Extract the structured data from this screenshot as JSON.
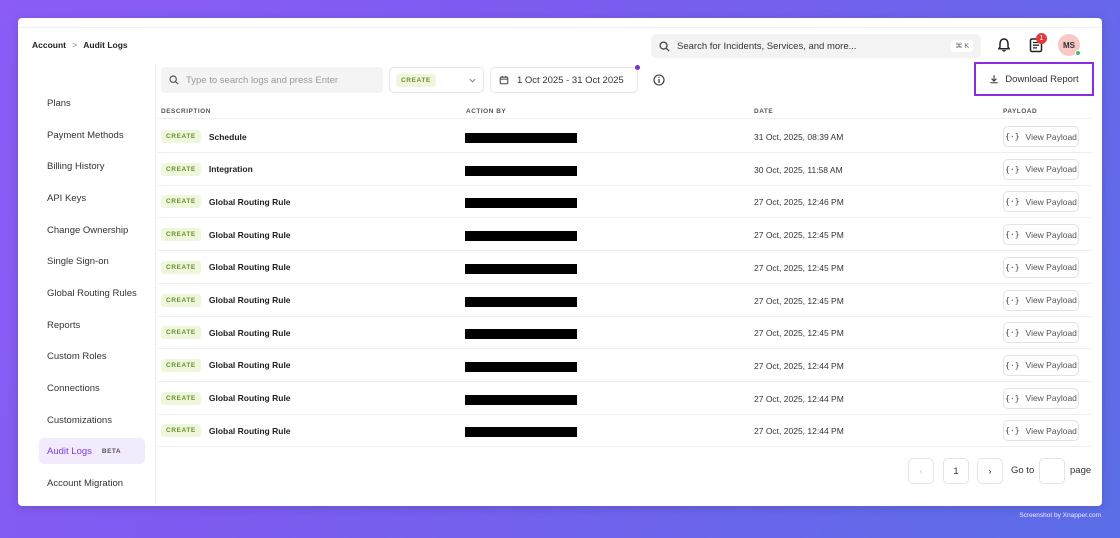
{
  "breadcrumb": {
    "parent": "Account",
    "separator": ">",
    "current": "Audit Logs"
  },
  "header": {
    "search_placeholder": "Search for Incidents, Services, and more...",
    "search_shortcut": "⌘ K",
    "notification_count": "1",
    "avatar_initials": "MS"
  },
  "sidebar": {
    "items": [
      {
        "label": "Plans"
      },
      {
        "label": "Payment Methods"
      },
      {
        "label": "Billing History"
      },
      {
        "label": "API Keys"
      },
      {
        "label": "Change Ownership"
      },
      {
        "label": "Single Sign-on"
      },
      {
        "label": "Global Routing Rules"
      },
      {
        "label": "Reports"
      },
      {
        "label": "Custom Roles"
      },
      {
        "label": "Connections"
      },
      {
        "label": "Customizations"
      },
      {
        "label": "Audit Logs",
        "badge": "BETA",
        "active": true
      },
      {
        "label": "Account Migration"
      }
    ]
  },
  "filters": {
    "search_placeholder": "Type to search logs and press Enter",
    "action_selected": "CREATE",
    "date_range": "1 Oct 2025 - 31 Oct 2025",
    "download_label": "Download Report"
  },
  "table": {
    "headers": {
      "description": "DESCRIPTION",
      "action_by": "ACTION BY",
      "date": "DATE",
      "payload": "PAYLOAD"
    },
    "rows": [
      {
        "action": "CREATE",
        "description": "Schedule",
        "date": "31 Oct, 2025, 08:39 AM",
        "payload_label": "View Payload"
      },
      {
        "action": "CREATE",
        "description": "Integration",
        "date": "30 Oct, 2025, 11:58 AM",
        "payload_label": "View Payload"
      },
      {
        "action": "CREATE",
        "description": "Global Routing Rule",
        "date": "27 Oct, 2025, 12:46 PM",
        "payload_label": "View Payload"
      },
      {
        "action": "CREATE",
        "description": "Global Routing Rule",
        "date": "27 Oct, 2025, 12:45 PM",
        "payload_label": "View Payload"
      },
      {
        "action": "CREATE",
        "description": "Global Routing Rule",
        "date": "27 Oct, 2025, 12:45 PM",
        "payload_label": "View Payload"
      },
      {
        "action": "CREATE",
        "description": "Global Routing Rule",
        "date": "27 Oct, 2025, 12:45 PM",
        "payload_label": "View Payload"
      },
      {
        "action": "CREATE",
        "description": "Global Routing Rule",
        "date": "27 Oct, 2025, 12:45 PM",
        "payload_label": "View Payload"
      },
      {
        "action": "CREATE",
        "description": "Global Routing Rule",
        "date": "27 Oct, 2025, 12:44 PM",
        "payload_label": "View Payload"
      },
      {
        "action": "CREATE",
        "description": "Global Routing Rule",
        "date": "27 Oct, 2025, 12:44 PM",
        "payload_label": "View Payload"
      },
      {
        "action": "CREATE",
        "description": "Global Routing Rule",
        "date": "27 Oct, 2025, 12:44 PM",
        "payload_label": "View Payload"
      }
    ]
  },
  "pagination": {
    "current_page": "1",
    "goto_label": "Go to",
    "page_label": "page",
    "prev": "‹",
    "next": "›"
  },
  "credit": "Screenshot by Xnapper.com",
  "colors": {
    "accent": "#8a2be2",
    "active_bg": "#f1ebfd",
    "tag_bg": "#eef7dc",
    "tag_text": "#6b8f2a"
  }
}
